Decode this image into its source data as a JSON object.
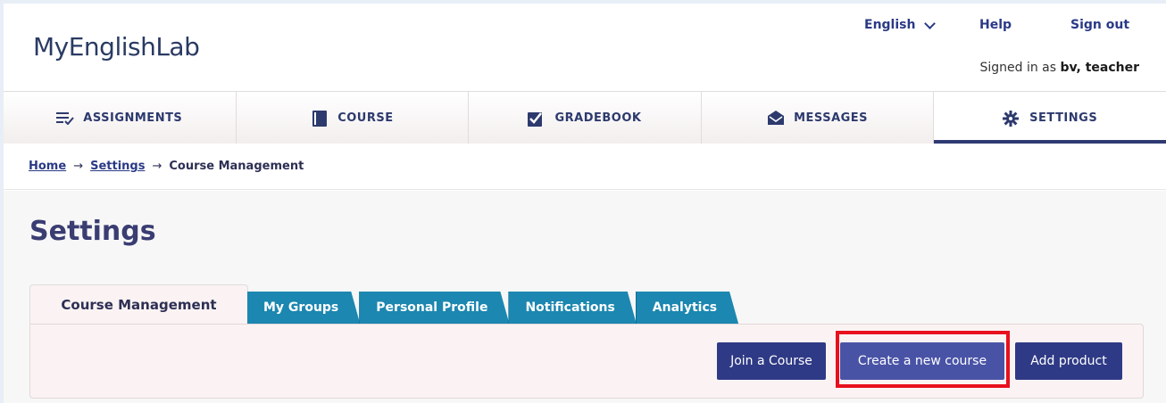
{
  "header": {
    "logo": "MyEnglishLab",
    "language": "English",
    "help": "Help",
    "sign_out": "Sign out",
    "signed_in_prefix": "Signed in as",
    "signed_in_user": "bv, teacher"
  },
  "nav": {
    "items": [
      {
        "label": "ASSIGNMENTS",
        "icon": "list-check-icon"
      },
      {
        "label": "COURSE",
        "icon": "book-icon"
      },
      {
        "label": "GRADEBOOK",
        "icon": "checkbox-icon"
      },
      {
        "label": "MESSAGES",
        "icon": "envelope-icon"
      },
      {
        "label": "SETTINGS",
        "icon": "gear-icon",
        "active": true
      }
    ]
  },
  "breadcrumb": {
    "home": "Home",
    "settings": "Settings",
    "current": "Course Management",
    "separator": "→"
  },
  "page": {
    "title": "Settings"
  },
  "tabs": {
    "active": "Course Management",
    "items": [
      "My Groups",
      "Personal Profile",
      "Notifications",
      "Analytics"
    ]
  },
  "actions": {
    "join": "Join a Course",
    "create": "Create a new course",
    "add": "Add product"
  },
  "colors": {
    "brand": "#2f3a86",
    "tab_blue": "#1c87b0",
    "highlight": "#e8101e"
  }
}
